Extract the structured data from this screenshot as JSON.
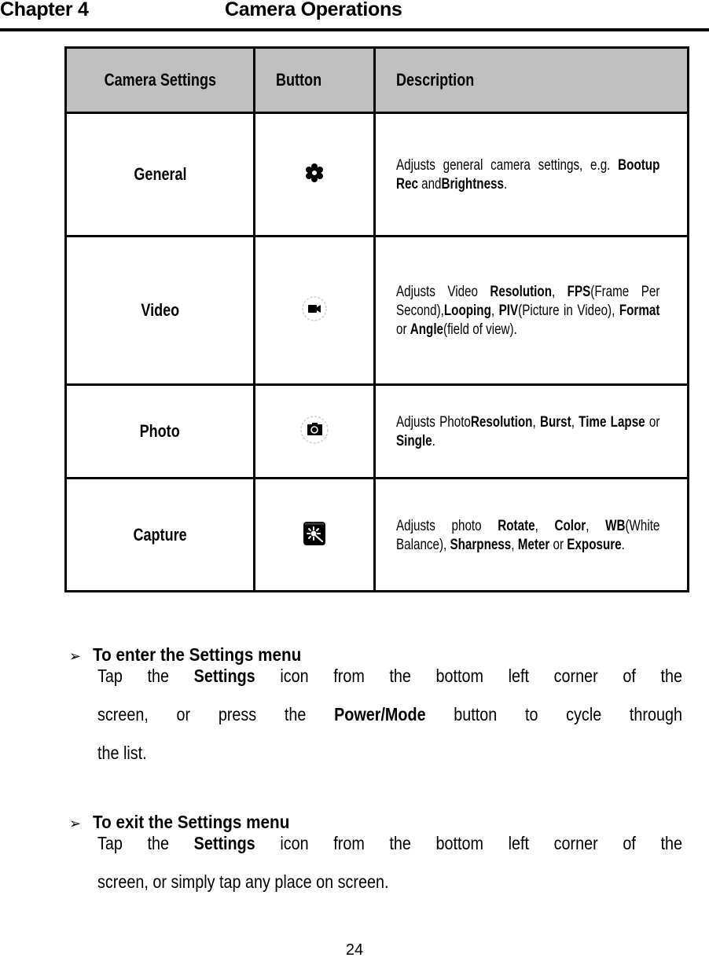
{
  "header": {
    "chapter_label": "Chapter 4",
    "chapter_title": "Camera Operations"
  },
  "table": {
    "headers": {
      "setting": "Camera Settings",
      "button": "Button",
      "description": "Description"
    },
    "header_bg": "#c0c0c0",
    "rows": [
      {
        "name": "General",
        "icon": "gear-icon",
        "description": [
          {
            "t": "Adjusts general camera settings, e.g. ",
            "b": false
          },
          {
            "t": "Bootup Rec",
            "b": true
          },
          {
            "t": " and",
            "b": false
          },
          {
            "t": "Brightness",
            "b": true
          },
          {
            "t": ".",
            "b": false
          }
        ]
      },
      {
        "name": "Video",
        "icon": "video-camera-icon",
        "description": [
          {
            "t": "Adjusts Video ",
            "b": false
          },
          {
            "t": "Resolution",
            "b": true
          },
          {
            "t": ", ",
            "b": false
          },
          {
            "t": "FPS",
            "b": true
          },
          {
            "t": "(Frame Per Second),",
            "b": false
          },
          {
            "t": "Looping",
            "b": true
          },
          {
            "t": ", ",
            "b": false
          },
          {
            "t": "PIV",
            "b": true
          },
          {
            "t": "(Picture in Video), ",
            "b": false
          },
          {
            "t": "Format",
            "b": true
          },
          {
            "t": " or ",
            "b": false
          },
          {
            "t": "Angle",
            "b": true
          },
          {
            "t": "(field of view).",
            "b": false
          }
        ]
      },
      {
        "name": "Photo",
        "icon": "photo-camera-icon",
        "description": [
          {
            "t": "Adjusts Photo",
            "b": false
          },
          {
            "t": "Resolution",
            "b": true
          },
          {
            "t": ", ",
            "b": false
          },
          {
            "t": "Burst",
            "b": true
          },
          {
            "t": ", ",
            "b": false
          },
          {
            "t": "Time Lapse",
            "b": true
          },
          {
            "t": " or ",
            "b": false
          },
          {
            "t": "Single",
            "b": true
          },
          {
            "t": ".",
            "b": false
          }
        ]
      },
      {
        "name": "Capture",
        "icon": "capture-settings-icon",
        "description": [
          {
            "t": "Adjusts photo ",
            "b": false
          },
          {
            "t": "Rotate",
            "b": true
          },
          {
            "t": ", ",
            "b": false
          },
          {
            "t": "Color",
            "b": true
          },
          {
            "t": ", ",
            "b": false
          },
          {
            "t": "WB",
            "b": true
          },
          {
            "t": "(White Balance), ",
            "b": false
          },
          {
            "t": "Sharpness",
            "b": true
          },
          {
            "t": ", ",
            "b": false
          },
          {
            "t": "Meter",
            "b": true
          },
          {
            "t": " or ",
            "b": false
          },
          {
            "t": "Exposure",
            "b": true
          },
          {
            "t": ".",
            "b": false
          }
        ]
      }
    ]
  },
  "sections": [
    {
      "title": "To enter the Settings menu",
      "lines": [
        [
          {
            "t": "Tap the ",
            "b": false
          },
          {
            "t": "Settings",
            "b": true
          },
          {
            "t": " icon from the bottom left corner of the",
            "b": false
          }
        ],
        [
          {
            "t": "screen, or press the ",
            "b": false
          },
          {
            "t": "Power/Mode",
            "b": true
          },
          {
            "t": " button to cycle through",
            "b": false
          }
        ],
        [
          {
            "t": "the list.",
            "b": false
          }
        ]
      ]
    },
    {
      "title": "To exit the Settings menu",
      "lines": [
        [
          {
            "t": "Tap the ",
            "b": false
          },
          {
            "t": "Settings",
            "b": true
          },
          {
            "t": " icon from the bottom left corner of the",
            "b": false
          }
        ],
        [
          {
            "t": "screen, or simply tap any place on screen.",
            "b": false
          }
        ]
      ]
    }
  ],
  "bullet_glyph": "➢",
  "page_number": "24"
}
